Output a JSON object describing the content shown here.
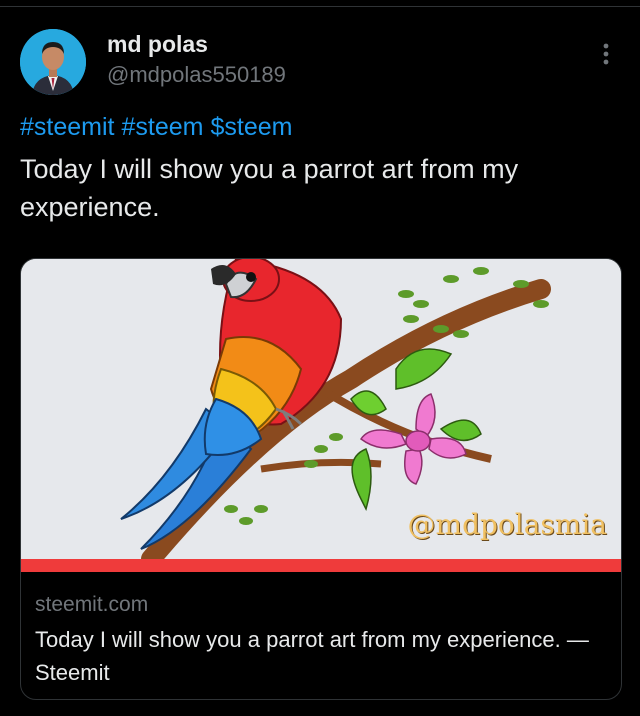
{
  "post": {
    "author_name": "md polas",
    "author_handle": "@mdpolas550189",
    "hashtags": [
      "#steemit",
      "#steem",
      "$steem"
    ],
    "text": "Today I will show you a parrot art from my experience."
  },
  "link_card": {
    "image_watermark": "@mdpolasmia",
    "domain": "steemit.com",
    "title": "Today I will show you a parrot art from my experience. — Steemit"
  },
  "colors": {
    "background": "#000000",
    "link": "#1d9bf0",
    "muted": "#71767b",
    "card_band": "#ef3b3b"
  }
}
